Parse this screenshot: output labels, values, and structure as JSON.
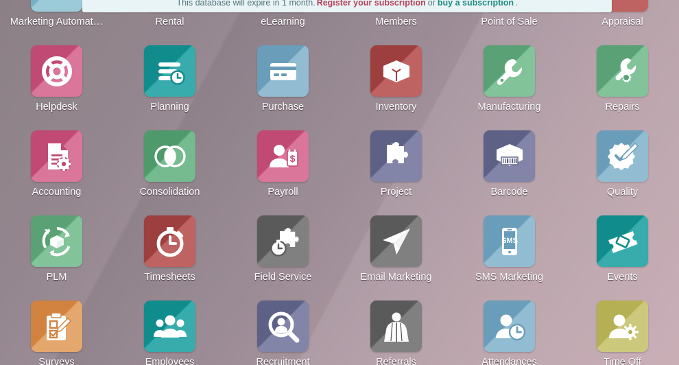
{
  "banner": {
    "message": "This database will expire in 1 month.",
    "link_register": "Register your subscription",
    "or": "or",
    "link_buy": "buy a subscription",
    "period": ".",
    "colors": {
      "background": "#e9f4f6",
      "text": "#55747c",
      "register": "#b5405a",
      "buy": "#1f8b82"
    }
  },
  "theme": {
    "background_dark": "#877a82",
    "background_light": "#c7abb3",
    "label_color": "#ffffff"
  },
  "apps": [
    {
      "label": "Marketing Automat…",
      "icon": "marketing-automation-icon",
      "color": "#76b0c4",
      "color2": "#8cc2d2"
    },
    {
      "label": "Rental",
      "icon": "rental-icon",
      "color": "#5d6185",
      "color2": "#6f739a"
    },
    {
      "label": "eLearning",
      "icon": "elearning-icon",
      "color": "#9e3f3f",
      "color2": "#b54b4b"
    },
    {
      "label": "Members",
      "icon": "members-icon",
      "color": "#4e9a6b",
      "color2": "#62b07f"
    },
    {
      "label": "Point of Sale",
      "icon": "point-of-sale-icon",
      "color": "#5a5a5a",
      "color2": "#6d6d6d"
    },
    {
      "label": "Appraisal",
      "icon": "appraisal-icon",
      "color": "#9e3f3f",
      "color2": "#b54b4b"
    },
    {
      "label": "Helpdesk",
      "icon": "lifebuoy-icon",
      "color": "#c04a74",
      "color2": "#d4628a"
    },
    {
      "label": "Planning",
      "icon": "planning-bars-clock-icon",
      "color": "#118c8c",
      "color2": "#1aa0a0"
    },
    {
      "label": "Purchase",
      "icon": "credit-card-icon",
      "color": "#6a9dba",
      "color2": "#82b2cb"
    },
    {
      "label": "Inventory",
      "icon": "open-box-icon",
      "color": "#9e3f3f",
      "color2": "#b54b4b"
    },
    {
      "label": "Manufacturing",
      "icon": "wrench-icon",
      "color": "#5aa275",
      "color2": "#6fba8b"
    },
    {
      "label": "Repairs",
      "icon": "wrench-gear-icon",
      "color": "#5aa275",
      "color2": "#6fba8b"
    },
    {
      "label": "Accounting",
      "icon": "document-gear-icon",
      "color": "#c04a74",
      "color2": "#d4628a"
    },
    {
      "label": "Consolidation",
      "icon": "two-circles-icon",
      "color": "#4e9a6b",
      "color2": "#62b07f"
    },
    {
      "label": "Payroll",
      "icon": "person-money-icon",
      "color": "#c04a74",
      "color2": "#d4628a"
    },
    {
      "label": "Project",
      "icon": "puzzle-piece-icon",
      "color": "#5d6185",
      "color2": "#6f739a"
    },
    {
      "label": "Barcode",
      "icon": "barcode-box-icon",
      "color": "#5d6185",
      "color2": "#6f739a"
    },
    {
      "label": "Quality",
      "icon": "badge-pencil-icon",
      "color": "#6a9dba",
      "color2": "#82b2cb"
    },
    {
      "label": "PLM",
      "icon": "cycle-box-icon",
      "color": "#5aa275",
      "color2": "#6fba8b"
    },
    {
      "label": "Timesheets",
      "icon": "stopwatch-icon",
      "color": "#9e3f3f",
      "color2": "#b54b4b"
    },
    {
      "label": "Field Service",
      "icon": "puzzle-stopwatch-icon",
      "color": "#5a5a5a",
      "color2": "#6d6d6d"
    },
    {
      "label": "Email Marketing",
      "icon": "paper-plane-icon",
      "color": "#5a5a5a",
      "color2": "#6d6d6d"
    },
    {
      "label": "SMS Marketing",
      "icon": "sms-phone-icon",
      "color": "#6a9dba",
      "color2": "#82b2cb"
    },
    {
      "label": "Events",
      "icon": "ticket-icon",
      "color": "#118c8c",
      "color2": "#1aa0a0"
    },
    {
      "label": "Surveys",
      "icon": "clipboard-pencil-icon",
      "color": "#d2833f",
      "color2": "#e09a57"
    },
    {
      "label": "Employees",
      "icon": "people-group-icon",
      "color": "#118c8c",
      "color2": "#1aa0a0"
    },
    {
      "label": "Recruitment",
      "icon": "person-magnifier-icon",
      "color": "#5d6185",
      "color2": "#6f739a"
    },
    {
      "label": "Referrals",
      "icon": "superhero-cape-icon",
      "color": "#5a5a5a",
      "color2": "#6d6d6d"
    },
    {
      "label": "Attendances",
      "icon": "person-clock-icon",
      "color": "#6a9dba",
      "color2": "#82b2cb"
    },
    {
      "label": "Time Off",
      "icon": "person-gear-icon",
      "color": "#b5b054",
      "color2": "#c6c168"
    }
  ]
}
